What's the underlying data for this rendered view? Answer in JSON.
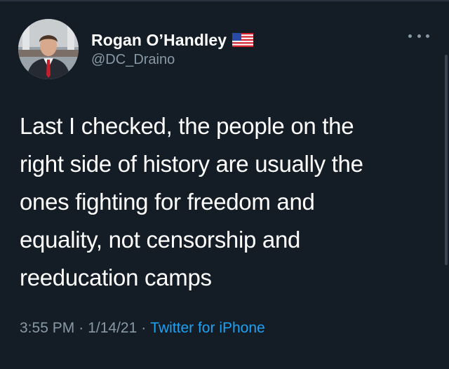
{
  "tweet": {
    "author": {
      "display_name": "Rogan O’Handley",
      "handle": "@DC_Draino",
      "badge_icon": "us-flag-icon",
      "avatar": "profile-photo"
    },
    "menu_icon": "more-options-icon",
    "text_lines": [
      "Last I checked, the people on the",
      "right side of history are usually the",
      "ones fighting for freedom and",
      "equality, not censorship and",
      "reeducation camps"
    ],
    "time": "3:55 PM",
    "separator": "·",
    "date": "1/14/21",
    "source": "Twitter for iPhone"
  },
  "colors": {
    "background": "#141d26",
    "text": "#ffffff",
    "secondary_text": "#8899a6",
    "link": "#1da1f2"
  }
}
